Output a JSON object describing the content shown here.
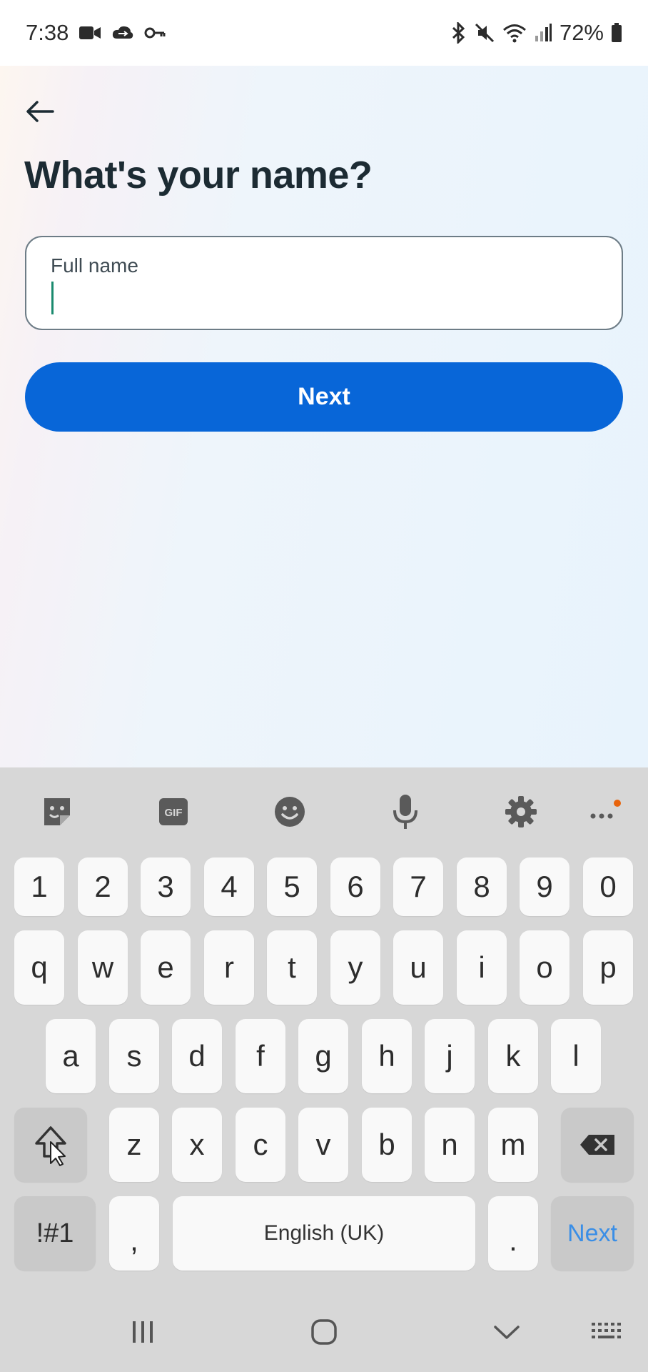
{
  "status_bar": {
    "time": "7:38",
    "battery": "72%",
    "left_icons": [
      "video-icon",
      "cloud-sync-icon",
      "key-icon"
    ],
    "right_icons": [
      "bluetooth-icon",
      "mute-icon",
      "wifi-icon",
      "signal-icon",
      "battery-icon"
    ]
  },
  "page": {
    "title": "What's your name?",
    "back_icon": "arrow-left-icon",
    "name_field": {
      "label": "Full name",
      "value": "",
      "placeholder": ""
    },
    "next_label": "Next",
    "colors": {
      "primary": "#0866d8",
      "title": "#1c2b33",
      "caret": "#1a8a6e"
    }
  },
  "keyboard": {
    "toolbar": [
      "sticker-icon",
      "gif-icon",
      "emoji-icon",
      "microphone-icon",
      "settings-icon",
      "more-icon"
    ],
    "toolbar_gif_label": "GIF",
    "rows": {
      "numbers": [
        "1",
        "2",
        "3",
        "4",
        "5",
        "6",
        "7",
        "8",
        "9",
        "0"
      ],
      "row1": [
        "q",
        "w",
        "e",
        "r",
        "t",
        "y",
        "u",
        "i",
        "o",
        "p"
      ],
      "row2": [
        "a",
        "s",
        "d",
        "f",
        "g",
        "h",
        "j",
        "k",
        "l"
      ],
      "row3": [
        "z",
        "x",
        "c",
        "v",
        "b",
        "n",
        "m"
      ]
    },
    "symbols_label": "!#1",
    "comma_label": ",",
    "space_label": "English (UK)",
    "period_label": ".",
    "enter_label": "Next",
    "accent_color": "#3a8ee6",
    "notification_dot_color": "#e8640c"
  },
  "nav_bar": {
    "icons": [
      "recents-icon",
      "home-icon",
      "back-chevron-icon",
      "keyboard-switch-icon"
    ]
  }
}
